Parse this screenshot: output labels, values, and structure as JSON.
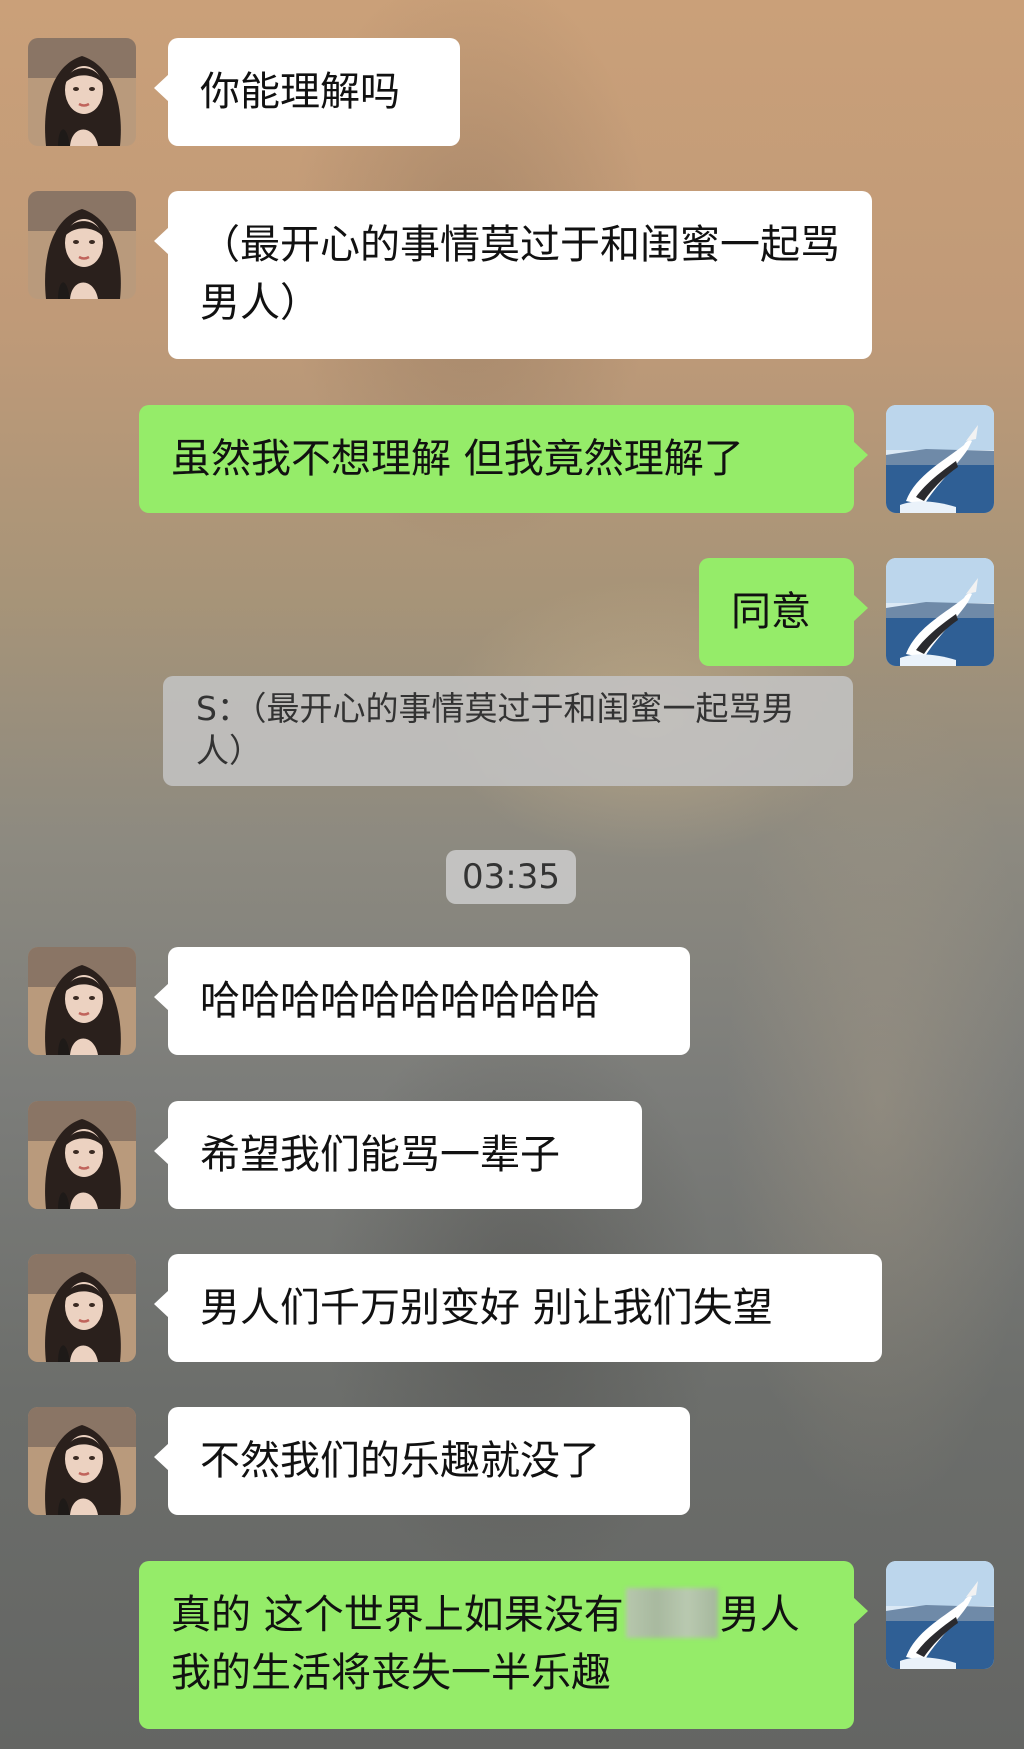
{
  "messages": [
    {
      "side": "in",
      "text": "你能理解吗"
    },
    {
      "side": "in",
      "text": "（最开心的事情莫过于和闺蜜一起骂男人）"
    },
    {
      "side": "out",
      "text": "虽然我不想理解 但我竟然理解了"
    },
    {
      "side": "out",
      "text": "同意"
    },
    {
      "quote": "S：（最开心的事情莫过于和闺蜜一起骂男人）"
    },
    {
      "timestamp": "03:35"
    },
    {
      "side": "in",
      "text": "哈哈哈哈哈哈哈哈哈哈"
    },
    {
      "side": "in",
      "text": "希望我们能骂一辈子"
    },
    {
      "side": "in",
      "text": "男人们千万别变好 别让我们失望"
    },
    {
      "side": "in",
      "text": "不然我们的乐趣就没了"
    },
    {
      "side": "out",
      "text_before": "真的 这个世界上如果没有",
      "redacted": true,
      "text_after": "男人 我的生活将丧失一半乐趣"
    }
  ],
  "icons": {
    "incoming_avatar": "avatar-girl-icon",
    "outgoing_avatar": "avatar-whale-icon"
  },
  "colors": {
    "incoming_bubble": "#ffffff",
    "outgoing_bubble": "#95ec69",
    "quote_bg": "#c8c8c8"
  }
}
